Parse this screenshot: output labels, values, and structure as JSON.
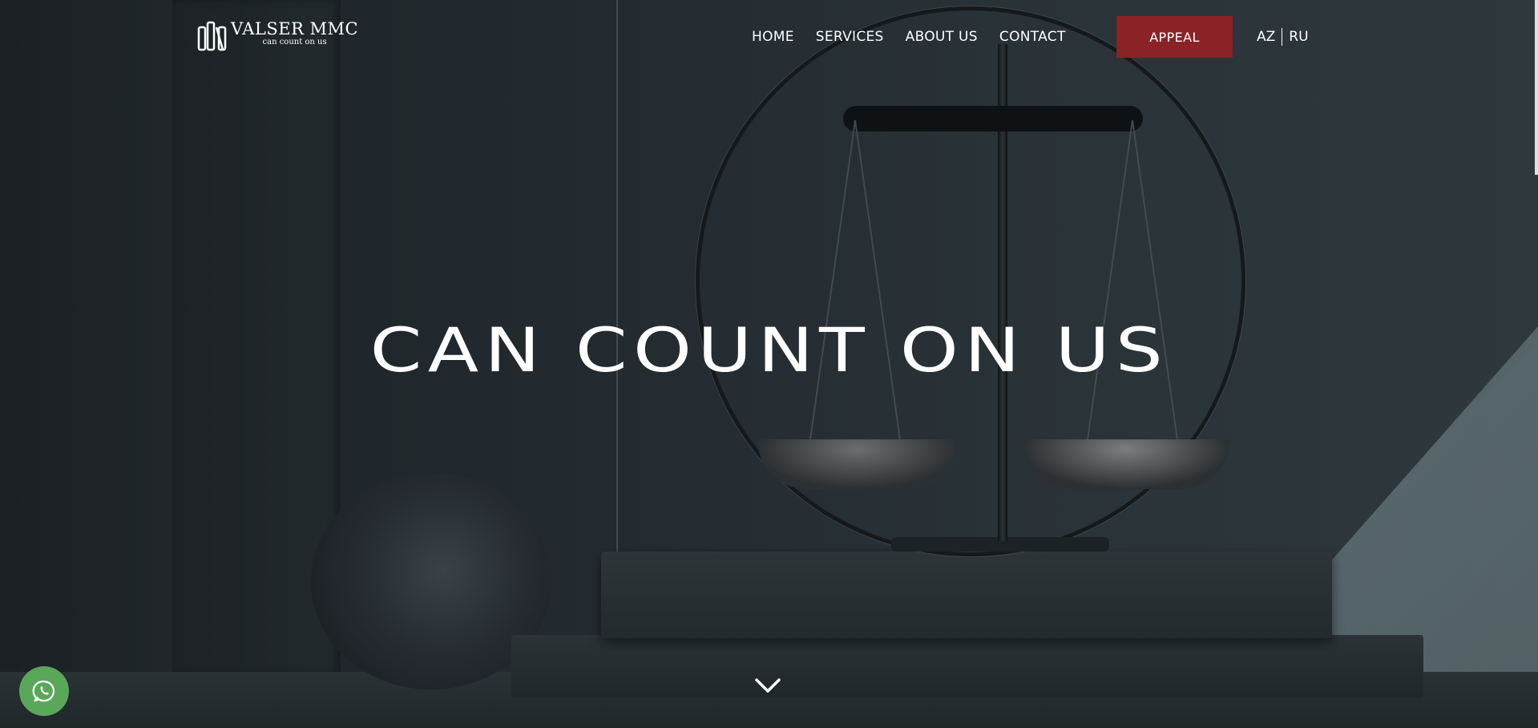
{
  "brand": {
    "name": "VALSER MMC",
    "tagline": "can count on us",
    "logo_icon": "building-columns-icon"
  },
  "nav": {
    "items": [
      {
        "label": "HOME"
      },
      {
        "label": "SERVICES"
      },
      {
        "label": "ABOUT US"
      },
      {
        "label": "CONTACT"
      }
    ],
    "appeal_label": "APPEAL"
  },
  "languages": [
    "AZ",
    "RU"
  ],
  "hero": {
    "title": "CAN COUNT ON US",
    "scroll_icon": "chevron-down-icon"
  },
  "floating": {
    "whatsapp_icon": "whatsapp-icon"
  },
  "colors": {
    "accent": "#8a2226",
    "whatsapp": "#59a85a",
    "text": "#ffffff"
  }
}
